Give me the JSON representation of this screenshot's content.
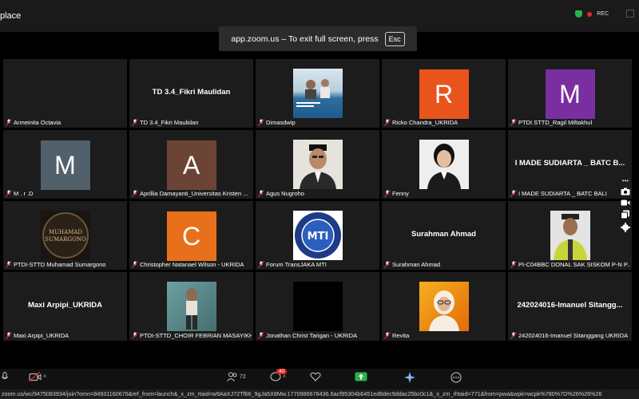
{
  "app": {
    "title": "place"
  },
  "recording": {
    "label": "REC",
    "status_color": "#e02828"
  },
  "banner": {
    "text": "app.zoom.us – To exit full screen, press",
    "key": "Esc"
  },
  "tiles": [
    {
      "name": "Armeinita Octavia",
      "type": "blank"
    },
    {
      "name": "TD 3.4_Fikri Maulidan",
      "type": "text",
      "display": "TD 3.4_Fikri Maulidan"
    },
    {
      "name": "Dimasdwip",
      "type": "photo"
    },
    {
      "name": "Ricko Chandra_UKRIDA",
      "type": "letter",
      "letter": "R",
      "color": "#e8541c"
    },
    {
      "name": "PTDI STTD_Ragil Miftakhul",
      "type": "letter",
      "letter": "M",
      "color": "#7a2fa0"
    },
    {
      "name": "M . r .D",
      "type": "letter",
      "letter": "M",
      "color": "#51606a"
    },
    {
      "name": "Aprillia Damayanti_Universitas Kristen ...",
      "type": "letter",
      "letter": "A",
      "color": "#6b4436"
    },
    {
      "name": "Agus Nugroho",
      "type": "photo"
    },
    {
      "name": "Fenny",
      "type": "photo"
    },
    {
      "name": "I MADE SUDIARTA _ BATC BALI",
      "type": "text",
      "display": "I MADE SUDIARTA _ BATC B..."
    },
    {
      "name": "PTDI-STTD Muhamad Sumargono",
      "type": "logo",
      "logo_text": "MUHAMAD SUMARGONO"
    },
    {
      "name": "Christopher Natanael Wilson - UKRIDA",
      "type": "letter",
      "letter": "C",
      "color": "#e8701a"
    },
    {
      "name": "Forum TransJAKA MTI",
      "type": "logo",
      "logo_text": "MTI"
    },
    {
      "name": "Surahman Ahmad",
      "type": "text",
      "display": "Surahman Ahmad"
    },
    {
      "name": "PI-C04BBC DONAL SAK SISKOM P-N P...",
      "type": "photo"
    },
    {
      "name": "Maxi Arpipi_UKRIDA",
      "type": "text",
      "display": "Maxi Arpipi_UKRIDA"
    },
    {
      "name": "PTDI-STTD_CHOIR FEBRIAN MASAYIKH",
      "type": "photo"
    },
    {
      "name": "Jonathan Christ Tarigan - UKRIDA",
      "type": "blank-video"
    },
    {
      "name": "Revita",
      "type": "photo"
    },
    {
      "name": "242024016-Imanuel Sitanggang UKRIDA",
      "type": "text",
      "display": "242024016-Imanuel Sitangg..."
    }
  ],
  "toolbar": {
    "participants_count": "72",
    "chat_badge": "40"
  },
  "address_bar": {
    "url": "zoom.us/wc/9475083934/join?omn=84931160676&ref_from=launch&_x_zm_rtaid=w9AaXJ72Tf66_9gJa5X8Mw.1770986678436.6acf95304b6451ed6dec9ddac25bc0c1&_x_zm_rhtaid=771&from=pwa&wpk=wcpk%780%7D%26%26%26"
  }
}
